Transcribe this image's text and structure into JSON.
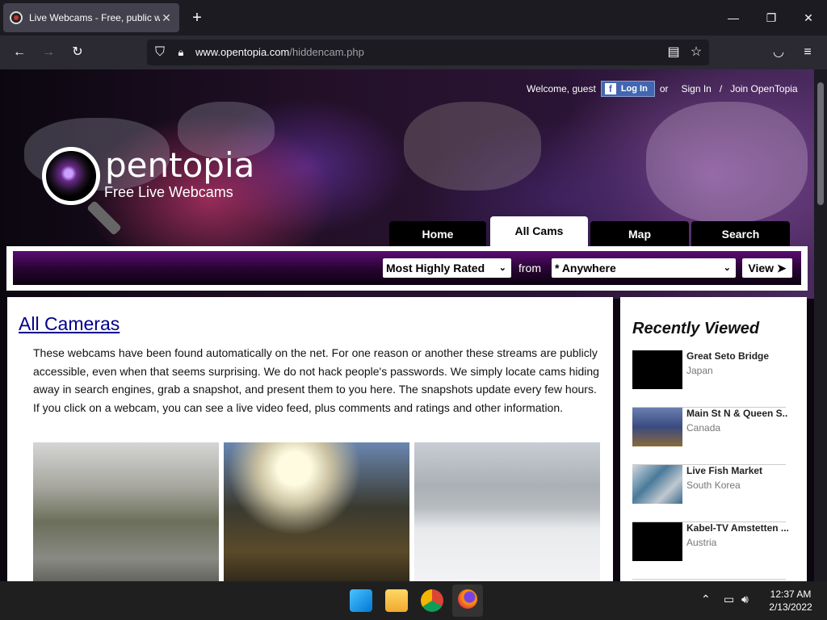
{
  "browser": {
    "tab_title": "Live Webcams - Free, public we",
    "url_host": "www.opentopia.com",
    "url_path": "/hiddencam.php"
  },
  "header": {
    "welcome": "Welcome, guest",
    "fb_login": "Log In",
    "or": "or",
    "sign_in": "Sign In",
    "separator": "/",
    "join": "Join OpenTopia",
    "logo_name": "pentopia",
    "logo_tagline": "Free Live Webcams"
  },
  "nav_tabs": [
    {
      "label": "Home",
      "active": false
    },
    {
      "label": "All Cams",
      "active": true
    },
    {
      "label": "Map",
      "active": false
    },
    {
      "label": "Search",
      "active": false
    }
  ],
  "filter": {
    "sort_value": "Most Highly Rated",
    "from_label": "from",
    "location_value": "* Anywhere",
    "view_label": "View ➤"
  },
  "main": {
    "heading": "All Cameras",
    "intro": "These webcams have been found automatically on the net. For one reason or another these streams are publicly accessible, even when that seems surprising. We do not hack people's passwords. We simply locate cams hiding away in search engines, grab a snapshot, and present them to you here. The snapshots update every few hours. If you click on a webcam, you can see a live video feed, plus comments and ratings and other information."
  },
  "recently_viewed": {
    "heading": "Recently Viewed",
    "items": [
      {
        "name": "Great Seto Bridge",
        "country": "Japan"
      },
      {
        "name": "Main St N & Queen S...",
        "country": "Canada"
      },
      {
        "name": "Live Fish Market",
        "country": "South Korea"
      },
      {
        "name": "Kabel-TV Amstetten ...",
        "country": "Austria"
      }
    ]
  },
  "taskbar": {
    "time": "12:37 AM",
    "date": "2/13/2022"
  },
  "colors": {
    "accent_purple": "#5a0d70",
    "link": "#00008b",
    "facebook": "#4267b2"
  }
}
